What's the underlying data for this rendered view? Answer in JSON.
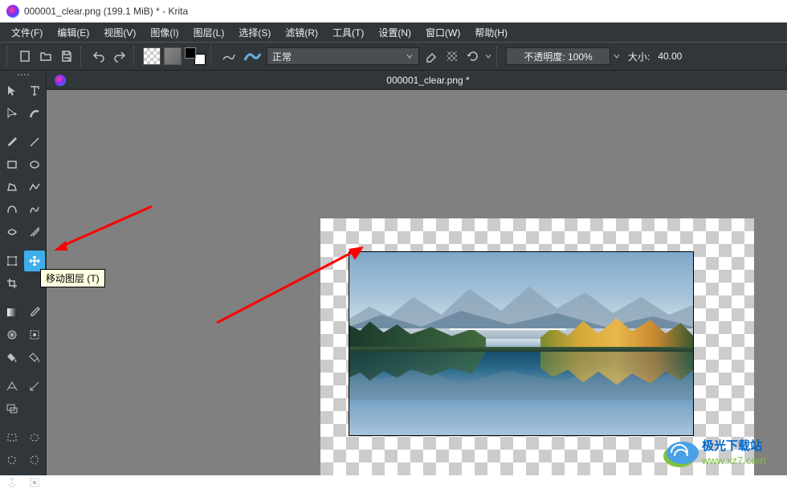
{
  "title": "000001_clear.png (199.1 MiB)  * - Krita",
  "menu": {
    "file": "文件(F)",
    "edit": "编辑(E)",
    "view": "视图(V)",
    "image": "图像(I)",
    "layer": "图层(L)",
    "select": "选择(S)",
    "filter": "滤镜(R)",
    "tool": "工具(T)",
    "settings": "设置(N)",
    "window": "窗口(W)",
    "help": "帮助(H)"
  },
  "toolbar": {
    "blend_mode": "正常",
    "opacity_label": "不透明度:  100%",
    "size_label": "大小:",
    "size_value": "40.00"
  },
  "document": {
    "tab_title": "000001_clear.png *"
  },
  "tooltip": "移动图层 (T)",
  "watermark": {
    "line1": "极光下载站",
    "line2": "www.xz7.com"
  }
}
